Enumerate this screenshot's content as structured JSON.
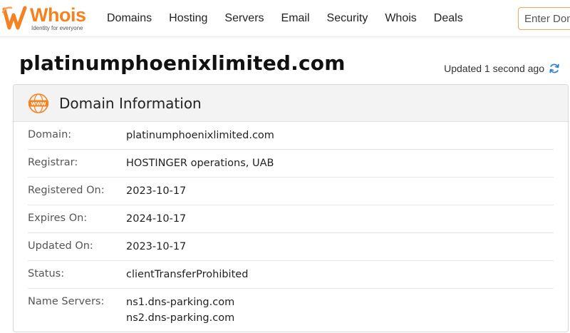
{
  "brand": {
    "name": "Whois",
    "tagline": "Identity for everyone",
    "accent": "#f58220",
    "logo_icon": "w-swoosh-logo-icon"
  },
  "nav": {
    "items": [
      "Domains",
      "Hosting",
      "Servers",
      "Email",
      "Security",
      "Whois",
      "Deals"
    ]
  },
  "search": {
    "placeholder": "Enter Domain"
  },
  "page": {
    "domain": "platinumphoenixlimited.com",
    "updated": "Updated 1 second ago",
    "refresh_icon": "refresh-icon"
  },
  "card": {
    "title": "Domain Information",
    "icon": "www-globe-icon",
    "rows": [
      {
        "label": "Domain:",
        "values": [
          "platinumphoenixlimited.com"
        ]
      },
      {
        "label": "Registrar:",
        "values": [
          "HOSTINGER operations, UAB"
        ]
      },
      {
        "label": "Registered On:",
        "values": [
          "2023-10-17"
        ]
      },
      {
        "label": "Expires On:",
        "values": [
          "2024-10-17"
        ]
      },
      {
        "label": "Updated On:",
        "values": [
          "2023-10-17"
        ]
      },
      {
        "label": "Status:",
        "values": [
          "clientTransferProhibited"
        ]
      },
      {
        "label": "Name Servers:",
        "values": [
          "ns1.dns-parking.com",
          "ns2.dns-parking.com"
        ]
      }
    ]
  }
}
